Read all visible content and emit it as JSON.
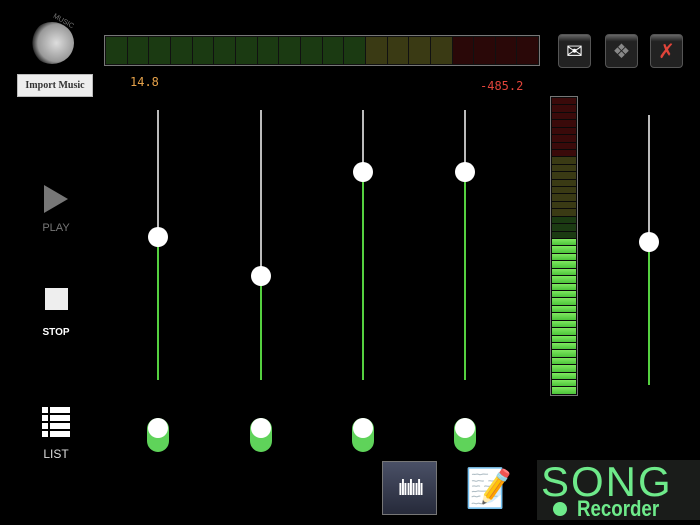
{
  "logo": {
    "label": "MUSIC"
  },
  "import_button": "Import Music",
  "top_meter": {
    "segments": [
      "green",
      "green",
      "green",
      "green",
      "green",
      "green",
      "green",
      "green",
      "green",
      "green",
      "green",
      "green",
      "olive",
      "olive",
      "olive",
      "olive",
      "red",
      "red",
      "red",
      "red"
    ],
    "lit": 0
  },
  "left_value": "14.8",
  "right_value": "-485.2",
  "share": {
    "email": "email-icon",
    "dropbox": "dropbox-icon",
    "delete": "delete-icon"
  },
  "transport": {
    "play": "PLAY",
    "stop": "STOP",
    "list": "LIST"
  },
  "sliders": [
    0.53,
    0.385,
    0.77,
    0.77
  ],
  "toggles": [
    true,
    true,
    true,
    true
  ],
  "master_slider": 0.53,
  "level_meter": {
    "segments": 40,
    "red": 8,
    "olive": 8,
    "dark_green": 3,
    "lit": 21
  },
  "colors": {
    "accent": "#55d040",
    "brand": "#6eea8a"
  },
  "brand": {
    "top": "SONG",
    "bottom": "Recorder"
  }
}
